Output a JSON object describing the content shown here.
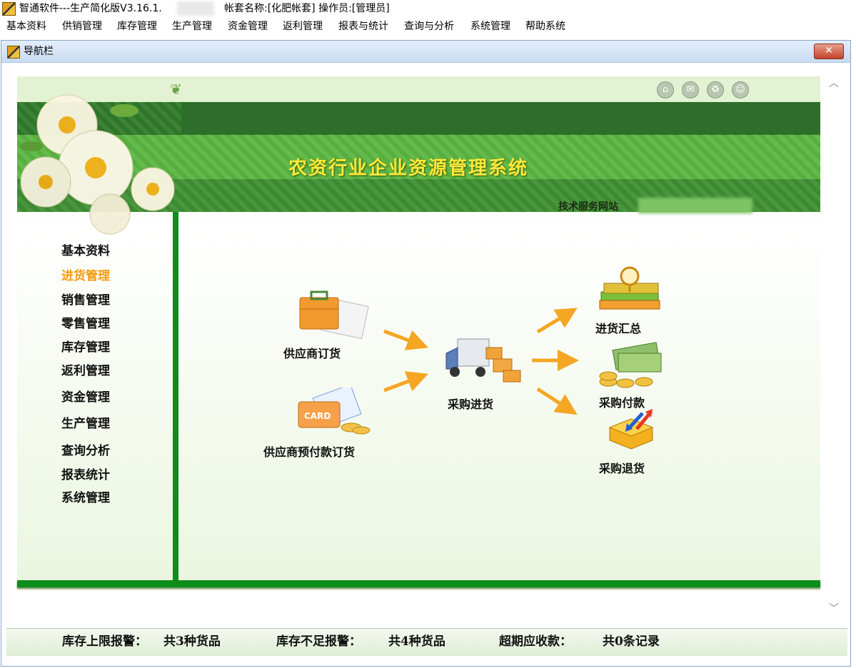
{
  "window": {
    "title": "智通软件---生产简化版V3.16.1.",
    "account": "帐套名称:[化肥帐套]  操作员:[管理员]"
  },
  "menubar": [
    "基本资料",
    "供销管理",
    "库存管理",
    "生产管理",
    "资金管理",
    "返利管理",
    "报表与统计",
    "查询与分析",
    "系统管理",
    "帮助系统"
  ],
  "child_window": {
    "title": "导航栏",
    "close_symbol": "✕"
  },
  "banner": {
    "title": "农资行业企业资源管理系统",
    "subtitle": "技术服务网站"
  },
  "top_icons": [
    "home-icon",
    "mail-icon",
    "recycle-icon",
    "smile-icon"
  ],
  "left_menu": {
    "items": [
      "基本资料",
      "进货管理",
      "销售管理",
      "零售管理",
      "库存管理",
      "返利管理",
      "资金管理",
      "生产管理",
      "查询分析",
      "报表统计",
      "系统管理"
    ],
    "active_index": 1,
    "active_color": "#f39b12"
  },
  "flow": {
    "supplier_order": "供应商订货",
    "supplier_prepay_order": "供应商预付款订货",
    "purchase_in": "采购进货",
    "purchase_summary": "进货汇总",
    "purchase_payment": "采购付款",
    "purchase_return": "采购退货",
    "card_text": "CARD"
  },
  "statusbar": {
    "stock_upper_label": "库存上限报警：",
    "stock_upper_value": "共3种货品",
    "stock_low_label": "库存不足报警：",
    "stock_low_value": "共4种货品",
    "overdue_label": "超期应收款：",
    "overdue_value": "共0条记录"
  },
  "colors": {
    "accent_green": "#0d8d1c",
    "banner_title": "#ffe93a",
    "arrow": "#f5a623"
  }
}
